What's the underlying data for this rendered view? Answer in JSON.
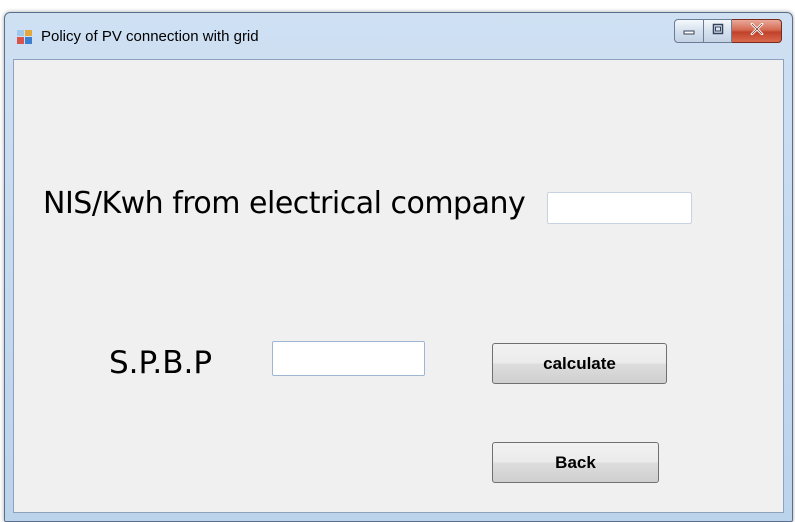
{
  "window": {
    "title": "Policy of PV connection with grid",
    "icon": "app-form-icon",
    "controls": {
      "minimize": "minimize-icon",
      "maximize": "maximize-icon",
      "close": "close-icon"
    }
  },
  "form": {
    "nis_label": "NIS/Kwh from electrical company",
    "nis_value": "",
    "spbp_label": "S.P.B.P",
    "spbp_value": "",
    "calculate_label": "calculate",
    "back_label": "Back"
  },
  "colors": {
    "client_background": "#f0f0f0",
    "titlebar": "#cfe0f3",
    "close_button": "#c1412a"
  }
}
